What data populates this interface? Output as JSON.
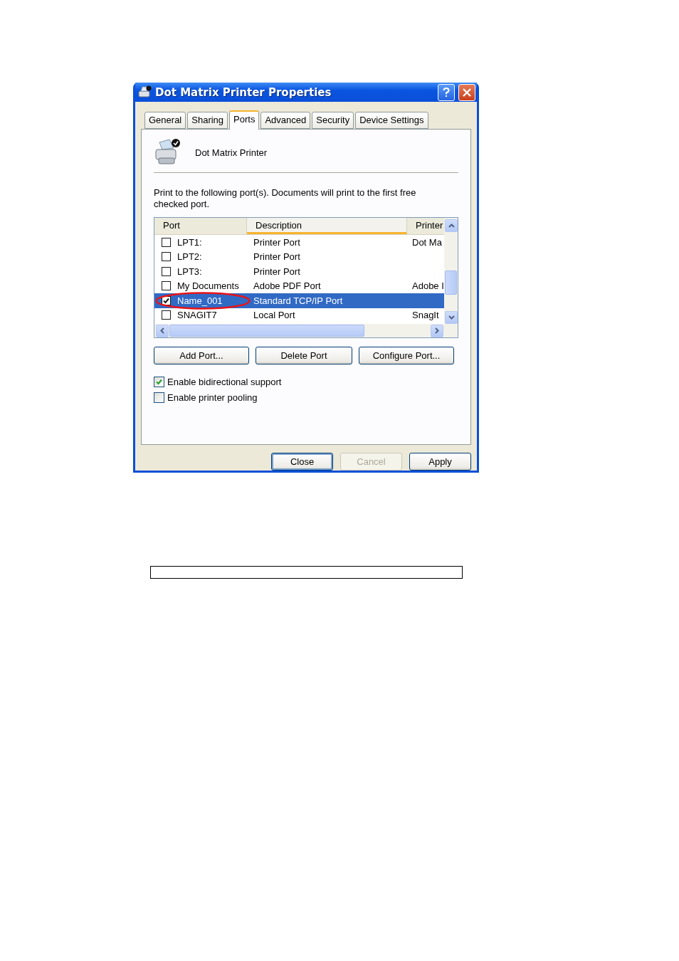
{
  "window": {
    "title": "Dot Matrix Printer Properties"
  },
  "tabs": [
    {
      "label": "General",
      "selected": false
    },
    {
      "label": "Sharing",
      "selected": false
    },
    {
      "label": "Ports",
      "selected": true
    },
    {
      "label": "Advanced",
      "selected": false
    },
    {
      "label": "Security",
      "selected": false
    },
    {
      "label": "Device Settings",
      "selected": false
    }
  ],
  "printer_name": "Dot Matrix Printer",
  "instructions": "Print to the following port(s). Documents will print to the first free checked port.",
  "port_list": {
    "columns": [
      {
        "label": "Port",
        "sorted": false
      },
      {
        "label": "Description",
        "sorted": true
      },
      {
        "label": "Printer",
        "sorted": false
      }
    ],
    "rows": [
      {
        "port": "LPT1:",
        "description": "Printer Port",
        "printer": "Dot Ma",
        "checked": false,
        "selected": false
      },
      {
        "port": "LPT2:",
        "description": "Printer Port",
        "printer": "",
        "checked": false,
        "selected": false
      },
      {
        "port": "LPT3:",
        "description": "Printer Port",
        "printer": "",
        "checked": false,
        "selected": false
      },
      {
        "port": "My Documents",
        "description": "Adobe PDF Port",
        "printer": "Adobe I",
        "checked": false,
        "selected": false
      },
      {
        "port": "Name_001",
        "description": "Standard TCP/IP Port",
        "printer": "",
        "checked": true,
        "selected": true
      },
      {
        "port": "SNAGIT7",
        "description": "Local Port",
        "printer": "SnagIt",
        "checked": false,
        "selected": false
      }
    ]
  },
  "port_buttons": [
    "Add Port...",
    "Delete Port",
    "Configure Port..."
  ],
  "options": [
    {
      "label": "Enable bidirectional support",
      "checked": true
    },
    {
      "label": "Enable printer pooling",
      "checked": false
    }
  ],
  "dialog_buttons": [
    {
      "label": "Close",
      "disabled": false,
      "default": true
    },
    {
      "label": "Cancel",
      "disabled": true,
      "default": false
    },
    {
      "label": "Apply",
      "disabled": false,
      "default": false
    }
  ]
}
